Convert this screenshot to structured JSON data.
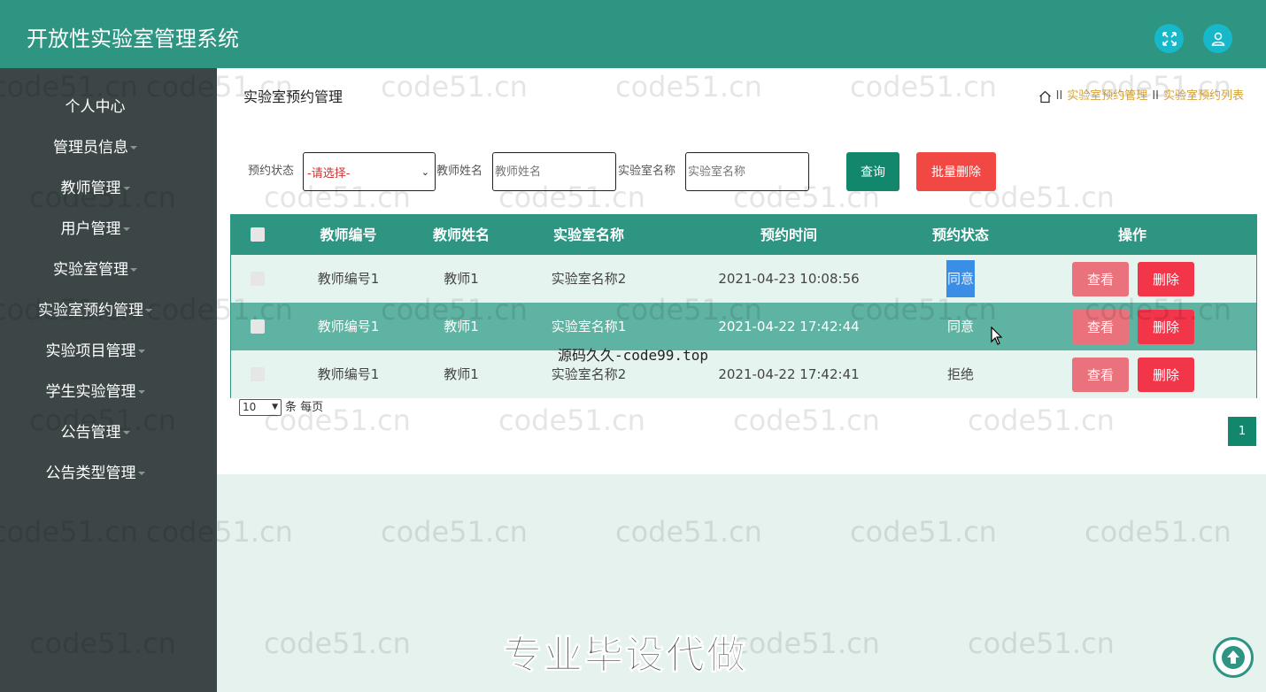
{
  "header": {
    "title": "开放性实验室管理系统"
  },
  "sidebar": {
    "items": [
      {
        "label": "个人中心"
      },
      {
        "label": "管理员信息"
      },
      {
        "label": "教师管理"
      },
      {
        "label": "用户管理"
      },
      {
        "label": "实验室管理"
      },
      {
        "label": "实验室预约管理"
      },
      {
        "label": "实验项目管理"
      },
      {
        "label": "学生实验管理"
      },
      {
        "label": "公告管理"
      },
      {
        "label": "公告类型管理"
      }
    ]
  },
  "page": {
    "title": "实验室预约管理",
    "breadcrumb": [
      "实验室预约管理",
      "实验室预约列表"
    ],
    "breadcrumb_sep": "II"
  },
  "search": {
    "status_label": "预约状态",
    "status_value": "-请选择-",
    "teacher_name_label": "教师姓名",
    "teacher_name_placeholder": "教师姓名",
    "lab_name_label": "实验室名称",
    "lab_name_placeholder": "实验室名称",
    "query_button": "查询",
    "batch_delete_button": "批量删除"
  },
  "table": {
    "headers": [
      "教师编号",
      "教师姓名",
      "实验室名称",
      "预约时间",
      "预约状态",
      "操作"
    ],
    "rows": [
      {
        "teacher_no": "教师编号1",
        "teacher_name": "教师1",
        "lab_name": "实验室名称2",
        "time": "2021-04-23 10:08:56",
        "status": "同意"
      },
      {
        "teacher_no": "教师编号1",
        "teacher_name": "教师1",
        "lab_name": "实验室名称1",
        "time": "2021-04-22 17:42:44",
        "status": "同意"
      },
      {
        "teacher_no": "教师编号1",
        "teacher_name": "教师1",
        "lab_name": "实验室名称2",
        "time": "2021-04-22 17:42:41",
        "status": "拒绝"
      }
    ],
    "view_button": "查看",
    "delete_button": "删除"
  },
  "pagination": {
    "page_size": "10",
    "page_size_label": "条 每页",
    "current_page": "1"
  },
  "overlay": {
    "source_text": "源码久久-code99.top",
    "banner_text": "专业毕设代做",
    "watermark": "code51.cn"
  },
  "colors": {
    "primary": "#2d9582",
    "sidebar": "#3c4646",
    "danger": "#f3354a",
    "view": "#e9727c",
    "accent_link": "#d8a339"
  }
}
